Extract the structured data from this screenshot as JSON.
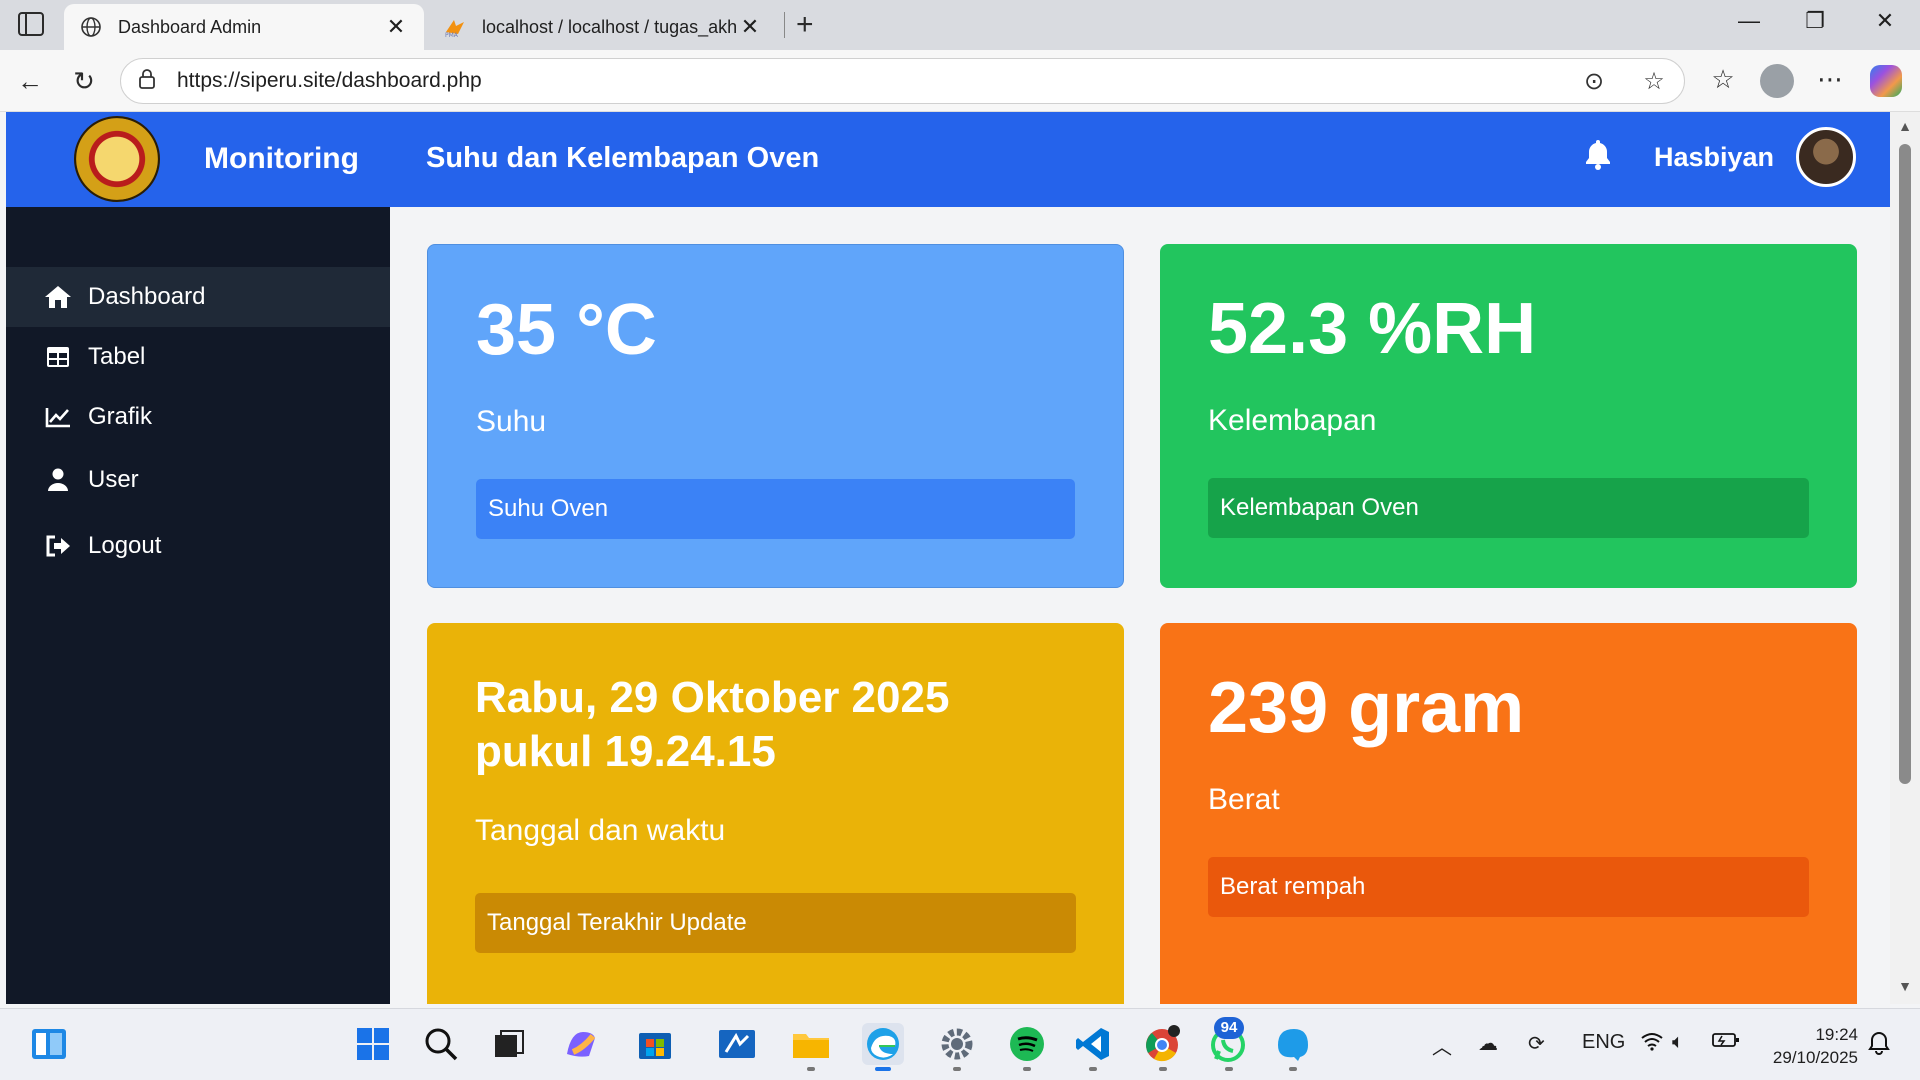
{
  "browser": {
    "tabs": [
      {
        "title": "Dashboard Admin",
        "icon": "globe-icon",
        "active": true
      },
      {
        "title": "localhost / localhost / tugas_akhir",
        "icon": "phpmyadmin-icon",
        "active": false
      }
    ],
    "url": "https://siperu.site/dashboard.php"
  },
  "header": {
    "brand": "Monitoring",
    "title": "Suhu dan Kelembapan Oven",
    "username": "Hasbiyan"
  },
  "sidebar": {
    "items": [
      {
        "label": "Dashboard",
        "icon": "home-icon"
      },
      {
        "label": "Tabel",
        "icon": "table-icon"
      },
      {
        "label": "Grafik",
        "icon": "chart-icon"
      },
      {
        "label": "User",
        "icon": "user-icon"
      },
      {
        "label": "Logout",
        "icon": "logout-icon"
      }
    ]
  },
  "cards": {
    "suhu": {
      "value": "35 °C",
      "label": "Suhu",
      "footer": "Suhu Oven",
      "color": "#60a5fa"
    },
    "kelembapan": {
      "value": "52.3 %RH",
      "label": "Kelembapan",
      "footer": "Kelembapan Oven",
      "color": "#22c55e"
    },
    "tanggal": {
      "value": "Rabu, 29 Oktober 2025 pukul 19.24.15",
      "label": "Tanggal dan waktu",
      "footer": "Tanggal Terakhir Update",
      "color": "#eab308"
    },
    "berat": {
      "value": "239 gram",
      "label": "Berat",
      "footer": "Berat rempah",
      "color": "#f97316"
    }
  },
  "taskbar": {
    "whatsapp_badge": "94",
    "language": "ENG",
    "time": "19:24",
    "date": "29/10/2025"
  }
}
